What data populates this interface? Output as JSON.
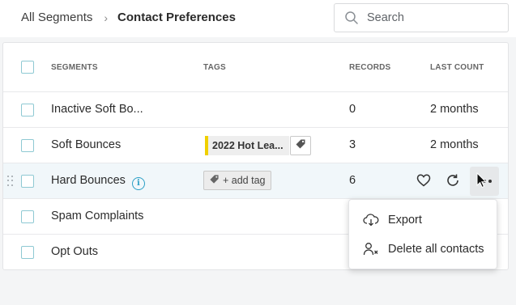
{
  "breadcrumb": {
    "root": "All Segments",
    "separator": "›",
    "current": "Contact Preferences"
  },
  "search": {
    "placeholder": "Search",
    "value": ""
  },
  "table": {
    "headers": {
      "segments": "SEGMENTS",
      "tags": "TAGS",
      "records": "RECORDS",
      "last_count": "LAST COUNT"
    },
    "rows": [
      {
        "name": "Inactive Soft Bo...",
        "tag": "",
        "records": "0",
        "last_count": "2 months"
      },
      {
        "name": "Soft Bounces",
        "tag": "2022 Hot Lea...",
        "records": "3",
        "last_count": "2 months"
      },
      {
        "name": "Hard Bounces",
        "tag": "+ add tag",
        "records": "6",
        "last_count": ""
      },
      {
        "name": "Spam Complaints",
        "tag": "",
        "records": "",
        "last_count": ""
      },
      {
        "name": "Opt Outs",
        "tag": "",
        "records": "",
        "last_count": ""
      }
    ]
  },
  "menu": {
    "items": [
      {
        "label": "Export",
        "icon": "cloud-download-icon"
      },
      {
        "label": "Delete all contacts",
        "icon": "remove-user-icon"
      }
    ]
  },
  "colors": {
    "accent": "#2b9fc6",
    "checkbox_border": "#8ec9d3",
    "tag_color": "#f0d000",
    "hover_row": "#f1f7fa"
  }
}
